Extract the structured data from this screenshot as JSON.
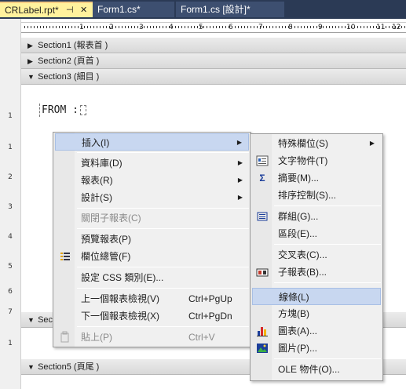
{
  "tabs": [
    {
      "label": "CRLabel.rpt*",
      "pin": "⊣",
      "close": "✕"
    },
    {
      "label": "Form1.cs*"
    },
    {
      "label": "Form1.cs [設計]*"
    }
  ],
  "ruler": {
    "numbers": [
      "1",
      "2",
      "3",
      "4",
      "5",
      "6",
      "7",
      "8",
      "9",
      "10",
      "11",
      "12"
    ],
    "vertical_1": [
      "1"
    ],
    "vertical_2": [
      "1",
      "2",
      "3",
      "4",
      "5",
      "6",
      "7"
    ],
    "vertical_3": [
      "1"
    ]
  },
  "sections": [
    {
      "label": "Section1 (報表首 )",
      "arrow": "▶"
    },
    {
      "label": "Section2 (頁首 )",
      "arrow": "▶"
    },
    {
      "label": "Section3 (細目 )",
      "arrow": "▼"
    },
    {
      "label": "Secti",
      "arrow": "▼"
    },
    {
      "label": "Section5 (頁尾 )",
      "arrow": "▼"
    }
  ],
  "field_text": "FROM :",
  "context_menu": {
    "items": [
      {
        "label": "插入(I)",
        "arrow": "▶"
      },
      {
        "label": "資料庫(D)",
        "arrow": "▶"
      },
      {
        "label": "報表(R)",
        "arrow": "▶"
      },
      {
        "label": "設計(S)",
        "arrow": "▶"
      },
      {
        "label": "關閉子報表(C)"
      },
      {
        "label": "預覽報表(P)"
      },
      {
        "label": "欄位總管(F)",
        "icon": "field-explorer-icon"
      },
      {
        "label": "設定 CSS 類別(E)..."
      },
      {
        "label": "上一個報表檢視(V)",
        "shortcut": "Ctrl+PgUp"
      },
      {
        "label": "下一個報表檢視(X)",
        "shortcut": "Ctrl+PgDn"
      },
      {
        "label": "貼上(P)",
        "shortcut": "Ctrl+V",
        "icon": "paste-icon"
      }
    ]
  },
  "insert_submenu": {
    "items": [
      {
        "label": "特殊欄位(S)",
        "arrow": "▶"
      },
      {
        "label": "文字物件(T)",
        "icon": "text-object-icon"
      },
      {
        "label": "摘要(M)...",
        "icon": "sigma-icon"
      },
      {
        "label": "排序控制(S)..."
      },
      {
        "label": "群組(G)...",
        "icon": "group-icon"
      },
      {
        "label": "區段(E)..."
      },
      {
        "label": "交叉表(C)..."
      },
      {
        "label": "子報表(B)...",
        "icon": "subreport-icon"
      },
      {
        "label": "線條(L)"
      },
      {
        "label": "方塊(B)"
      },
      {
        "label": "圖表(A)...",
        "icon": "chart-icon"
      },
      {
        "label": "圖片(P)...",
        "icon": "picture-icon"
      },
      {
        "label": "OLE 物件(O)..."
      }
    ]
  },
  "colors": {
    "tab_active": "#fff29d",
    "tab_strip": "#2b3a55",
    "menu_bg": "#f0f0f0",
    "menu_highlight": "#c8d7f0"
  }
}
